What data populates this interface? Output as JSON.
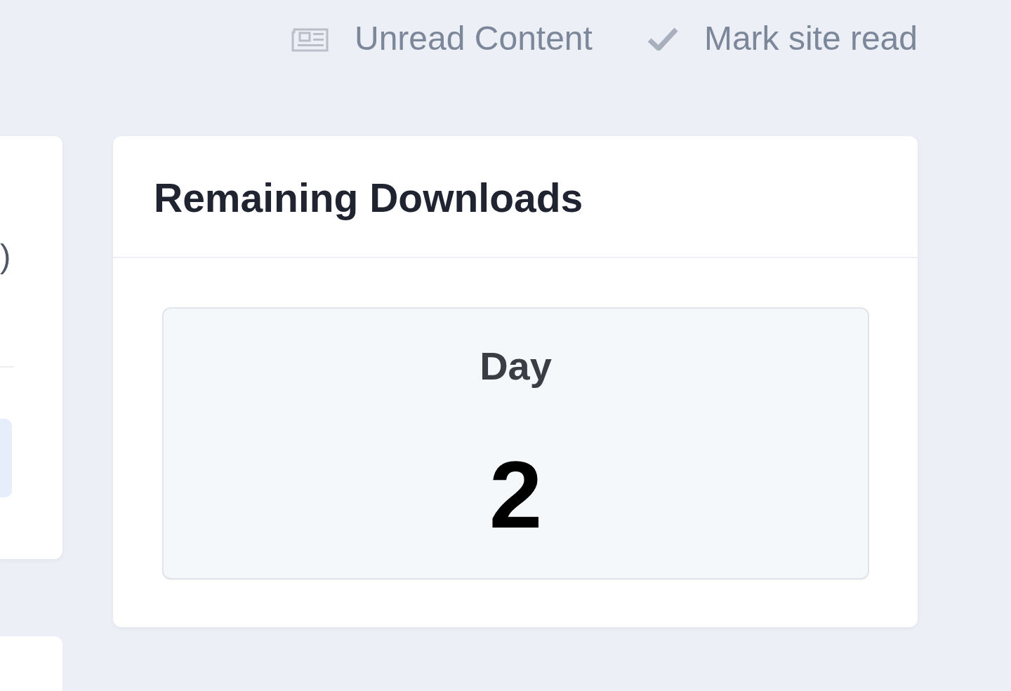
{
  "header_links": [
    {
      "kind": "newspaper",
      "label": "Unread Content"
    },
    {
      "kind": "check",
      "label": "Mark site read"
    }
  ],
  "left_card": {
    "text_fragment": ")"
  },
  "panel": {
    "title": "Remaining Downloads",
    "stats": [
      {
        "label": "Day",
        "value": "2"
      }
    ]
  }
}
